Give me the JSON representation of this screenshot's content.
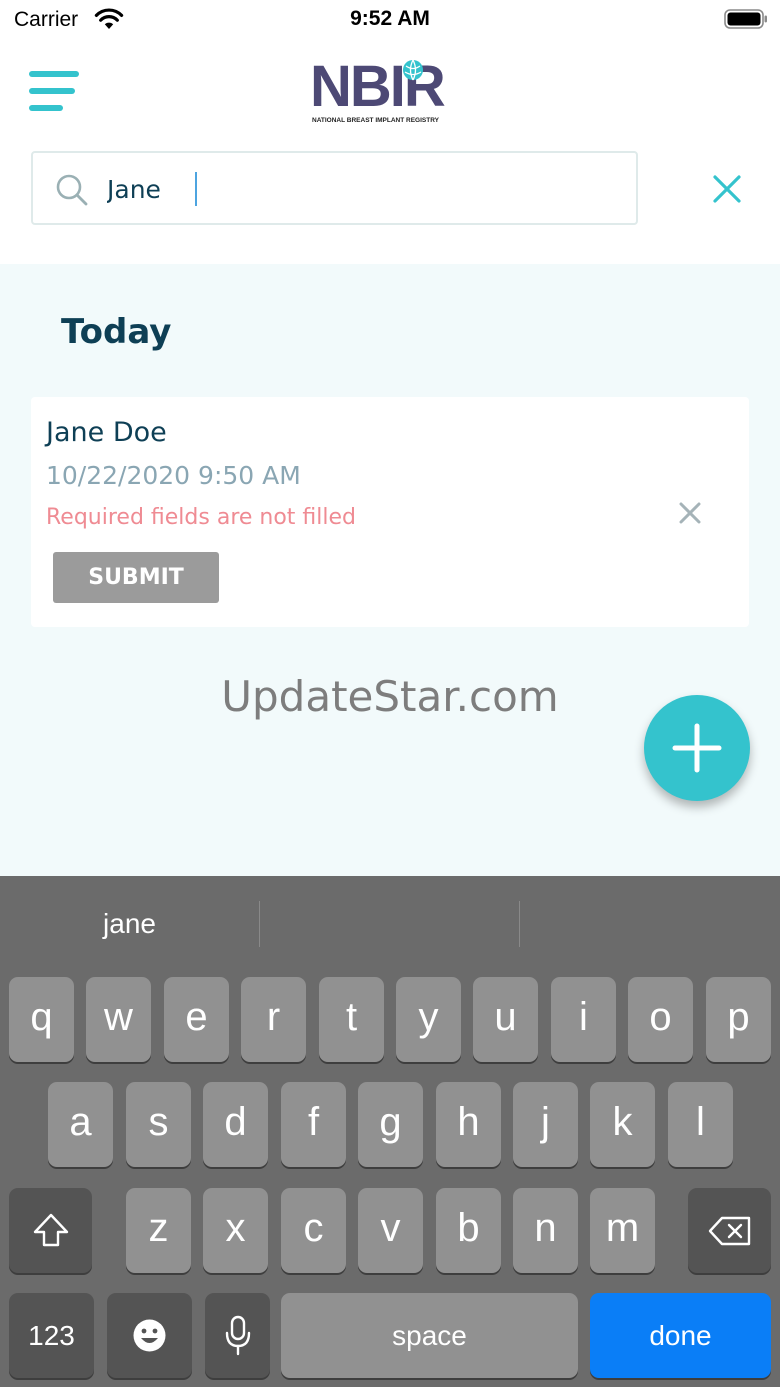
{
  "status_bar": {
    "carrier": "Carrier",
    "time": "9:52 AM"
  },
  "header": {
    "logo_text": "NBIR",
    "logo_subtitle": "NATIONAL BREAST IMPLANT REGISTRY"
  },
  "search": {
    "value": "Jane",
    "placeholder": ""
  },
  "content": {
    "section_title": "Today",
    "entries": [
      {
        "name": "Jane Doe",
        "datetime": "10/22/2020 9:50 AM",
        "error": "Required fields are not filled",
        "submit_label": "SUBMIT"
      }
    ],
    "watermark": "UpdateStar.com"
  },
  "keyboard": {
    "suggestions": [
      "jane",
      "",
      ""
    ],
    "row1": [
      "q",
      "w",
      "e",
      "r",
      "t",
      "y",
      "u",
      "i",
      "o",
      "p"
    ],
    "row2": [
      "a",
      "s",
      "d",
      "f",
      "g",
      "h",
      "j",
      "k",
      "l"
    ],
    "row3": [
      "z",
      "x",
      "c",
      "v",
      "b",
      "n",
      "m"
    ],
    "numbers_label": "123",
    "space_label": "space",
    "done_label": "done"
  },
  "colors": {
    "accent": "#34c3cd",
    "dark_text": "#0e3f55",
    "logo_purple": "#4d4975",
    "error": "#ef8b93",
    "done_key": "#0a7ef7"
  },
  "icons": {
    "menu": "hamburger-icon",
    "search": "search-icon",
    "clear": "close-icon",
    "delete_entry": "close-icon",
    "fab": "plus-icon",
    "shift": "shift-icon",
    "backspace": "backspace-icon",
    "emoji": "emoji-icon",
    "dictation": "microphone-icon"
  }
}
